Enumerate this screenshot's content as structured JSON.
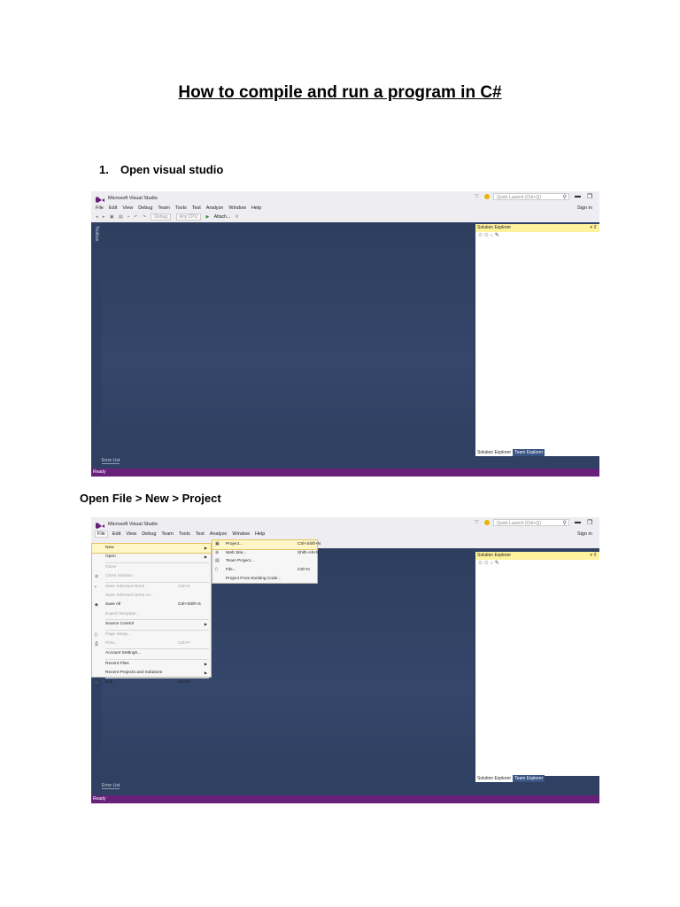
{
  "document": {
    "title": "How to compile and run a program in C#",
    "step1": {
      "number": "1.",
      "text": "Open visual studio"
    },
    "step2": {
      "text": "Open File > New > Project"
    }
  },
  "vs": {
    "window_title": "Microsoft Visual Studio",
    "menu": [
      "File",
      "Edit",
      "View",
      "Debug",
      "Team",
      "Tools",
      "Test",
      "Analyze",
      "Window",
      "Help"
    ],
    "toolbar": {
      "config": "Debug",
      "platform": "Any CPU",
      "attach": "Attach..."
    },
    "quick_launch_placeholder": "Quick Launch (Ctrl+Q)",
    "sign_in": "Sign in",
    "toolbox_tab": "Toolbox",
    "solution_explorer_title": "Solution Explorer",
    "tab_solution_explorer": "Solution Explorer",
    "tab_team_explorer": "Team Explorer",
    "error_list": "Error List",
    "status": "Ready",
    "accent_status": "#68217a",
    "accent_logo": "#68217a"
  },
  "file_menu": {
    "items": [
      {
        "label": "New",
        "shortcut": "",
        "submenu": true,
        "dim": false,
        "icon": ""
      },
      {
        "label": "Open",
        "shortcut": "",
        "submenu": true,
        "dim": false,
        "icon": ""
      },
      {
        "label": "Close",
        "shortcut": "",
        "submenu": false,
        "dim": true,
        "icon": ""
      },
      {
        "label": "Close Solution",
        "shortcut": "",
        "submenu": false,
        "dim": true,
        "icon": "close-solution-icon"
      },
      {
        "label": "Save Selected Items",
        "shortcut": "Ctrl+S",
        "submenu": false,
        "dim": true,
        "icon": "save-icon"
      },
      {
        "label": "Save Selected Items As...",
        "shortcut": "",
        "submenu": false,
        "dim": true,
        "icon": ""
      },
      {
        "label": "Save All",
        "shortcut": "Ctrl+Shift+S",
        "submenu": false,
        "dim": false,
        "icon": "save-all-icon"
      },
      {
        "label": "Export Template...",
        "shortcut": "",
        "submenu": false,
        "dim": true,
        "icon": ""
      },
      {
        "label": "Source Control",
        "shortcut": "",
        "submenu": true,
        "dim": false,
        "icon": ""
      },
      {
        "label": "Page Setup...",
        "shortcut": "",
        "submenu": false,
        "dim": true,
        "icon": "page-setup-icon"
      },
      {
        "label": "Print...",
        "shortcut": "Ctrl+P",
        "submenu": false,
        "dim": true,
        "icon": "print-icon"
      },
      {
        "label": "Account Settings...",
        "shortcut": "",
        "submenu": false,
        "dim": false,
        "icon": ""
      },
      {
        "label": "Recent Files",
        "shortcut": "",
        "submenu": true,
        "dim": false,
        "icon": ""
      },
      {
        "label": "Recent Projects and Solutions",
        "shortcut": "",
        "submenu": true,
        "dim": false,
        "icon": ""
      },
      {
        "label": "Exit",
        "shortcut": "Alt+F4",
        "submenu": false,
        "dim": false,
        "icon": "exit-icon"
      }
    ]
  },
  "new_submenu": {
    "items": [
      {
        "label": "Project...",
        "shortcut": "Ctrl+Shift+N",
        "icon": "project-icon"
      },
      {
        "label": "Web Site...",
        "shortcut": "Shift+Alt+N",
        "icon": "web-site-icon"
      },
      {
        "label": "Team Project...",
        "shortcut": "",
        "icon": "team-project-icon"
      },
      {
        "label": "File...",
        "shortcut": "Ctrl+N",
        "icon": "file-icon"
      },
      {
        "label": "Project From Existing Code...",
        "shortcut": "",
        "icon": ""
      }
    ]
  }
}
